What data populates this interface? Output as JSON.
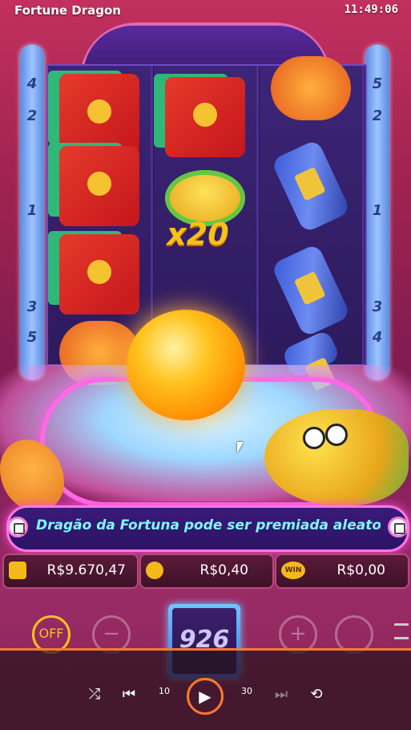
{
  "window": {
    "title": "Fortune Dragon",
    "clock": "11:49:06"
  },
  "paylines": {
    "left": [
      "4",
      "2",
      "1",
      "3",
      "5"
    ],
    "right": [
      "5",
      "2",
      "1",
      "3",
      "4"
    ]
  },
  "reels": [
    {
      "symbols": [
        "red-envelope-icon",
        "red-envelope-icon",
        "red-envelope-icon",
        "lantern-icon"
      ]
    },
    {
      "symbols": [
        "red-envelope-icon",
        "gold-hat-icon"
      ]
    },
    {
      "symbols": [
        "lantern-icon",
        "firecracker-icon",
        "firecracker-icon",
        "firecracker-icon"
      ]
    }
  ],
  "hat_multiplier": "x20",
  "marquee": {
    "text": "Dragão da Fortuna pode ser premiada aleatoriame"
  },
  "stats": {
    "balance": "R$9.670,47",
    "bet": "R$0,40",
    "win": "R$0,00",
    "win_badge": "WIN"
  },
  "controls": {
    "turbo_label": "OFF",
    "spin_count": "926",
    "minus": "−",
    "plus": "+"
  },
  "player": {
    "progress": 1.0,
    "shuffle": "⤮",
    "prev": "⏮",
    "back10": "10",
    "play": "▶",
    "fwd30": "30",
    "next": "⏭",
    "repeat": "⟲"
  },
  "colors": {
    "accent": "#ff7a2e",
    "marquee_text": "#7dfcff",
    "frame_glow": "#ff69e6"
  }
}
